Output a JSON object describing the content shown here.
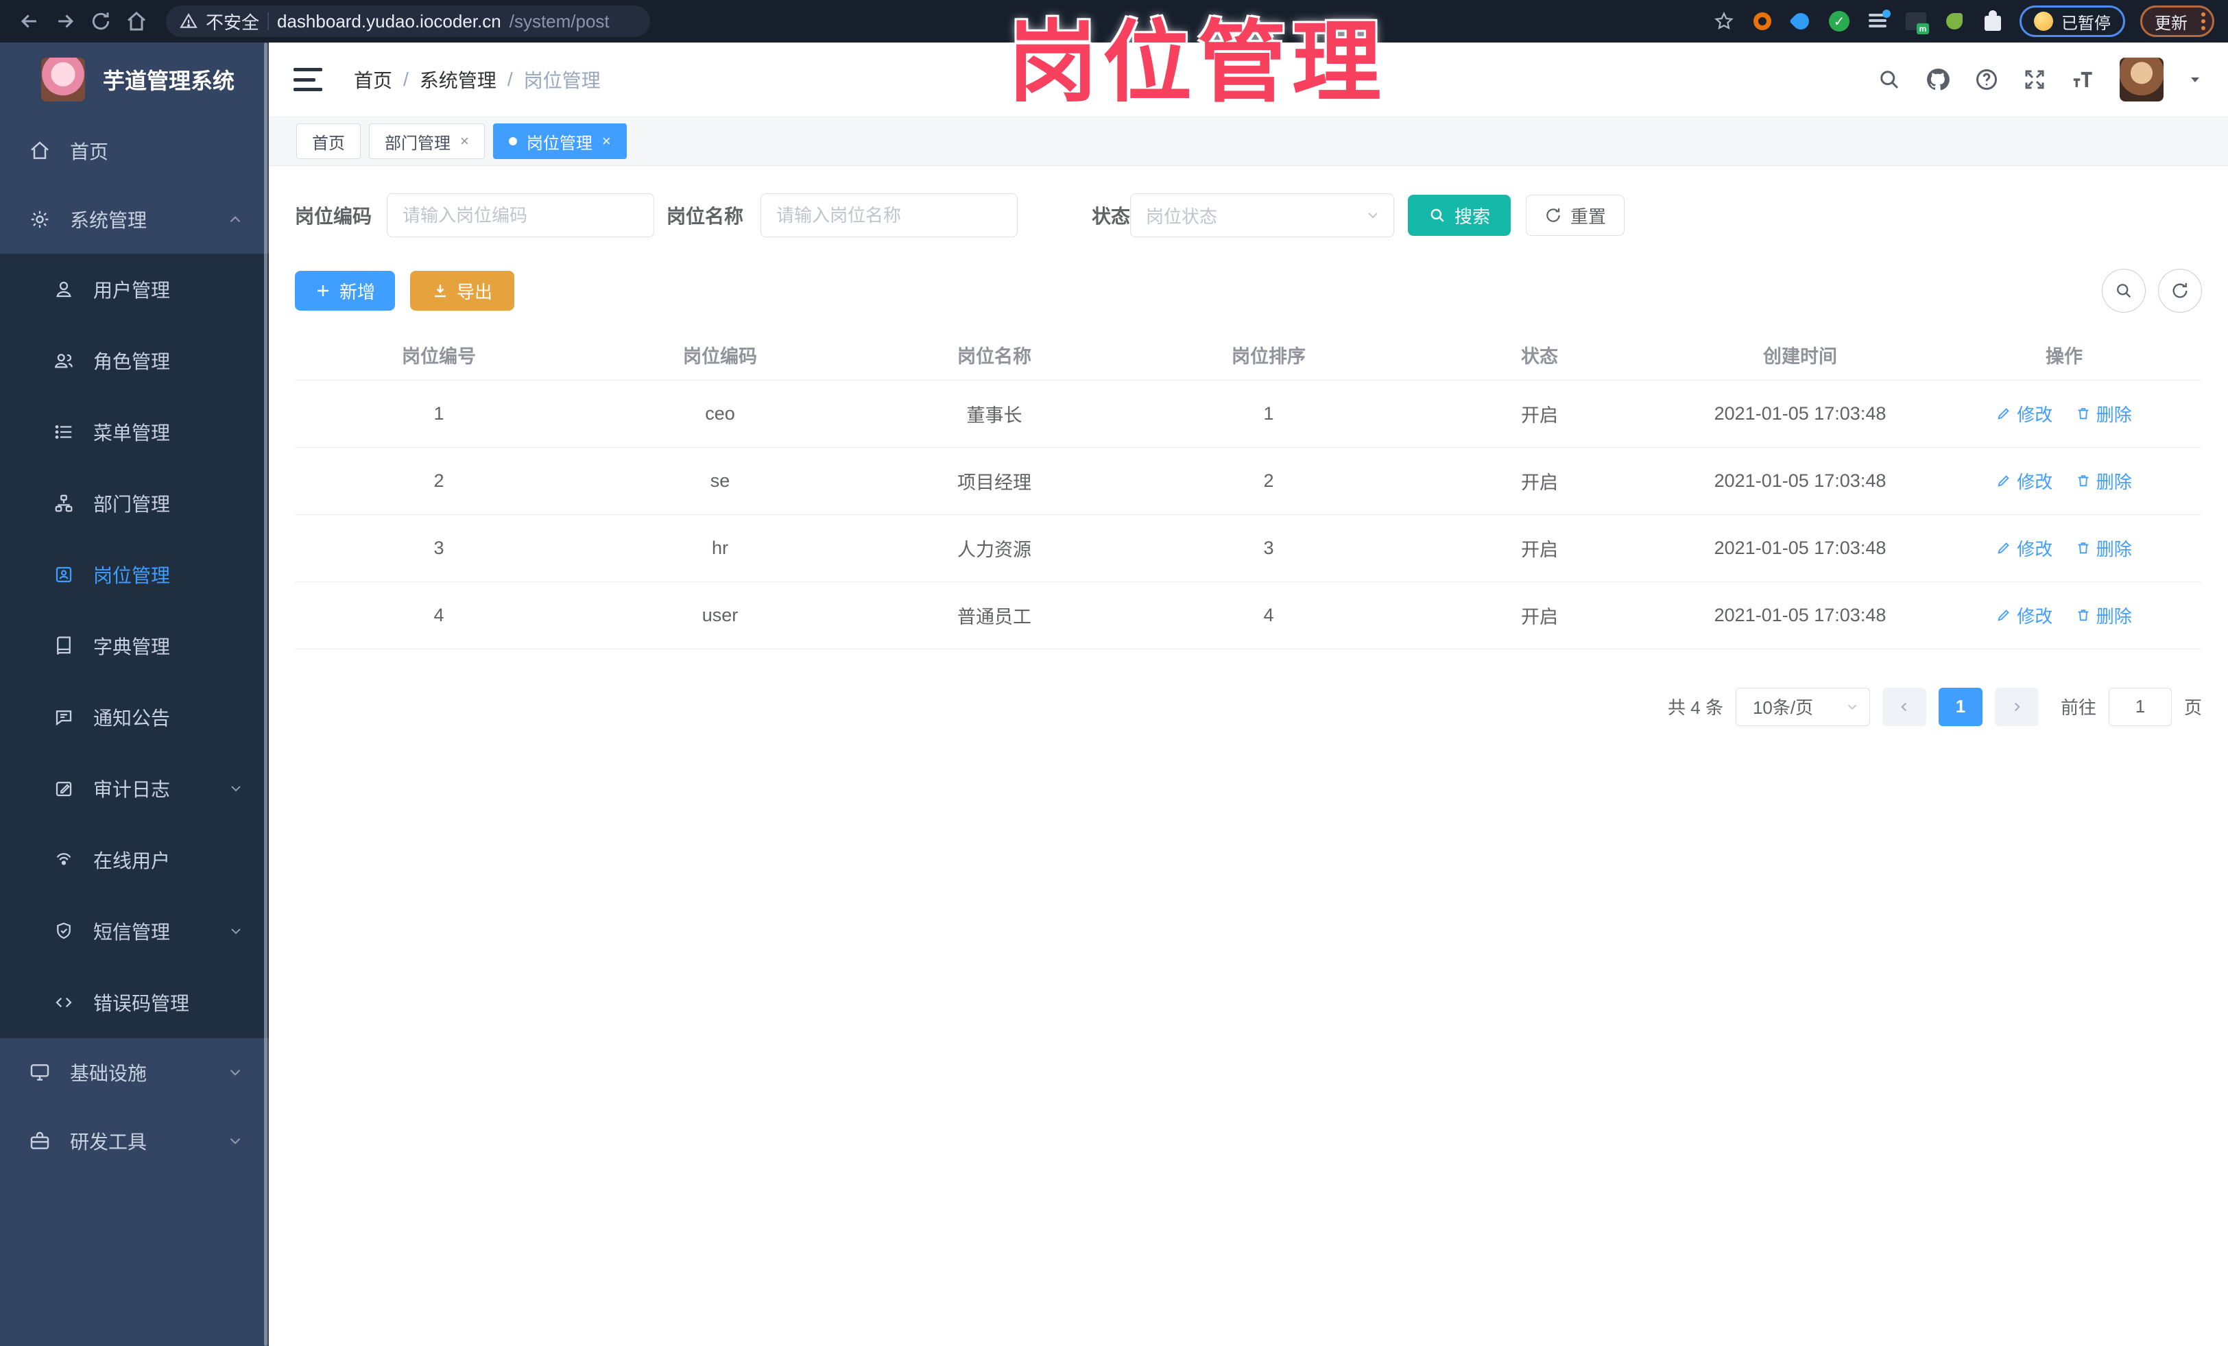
{
  "overlay_title": "岗位管理",
  "browser": {
    "security_label": "不安全",
    "url_host": "dashboard.yudao.iocoder.cn",
    "url_path": "/system/post",
    "paused_badge": "已暂停",
    "update_button": "更新"
  },
  "sidebar": {
    "app_title": "芋道管理系统",
    "home": "首页",
    "system": "系统管理",
    "submenu": [
      {
        "label": "用户管理"
      },
      {
        "label": "角色管理"
      },
      {
        "label": "菜单管理"
      },
      {
        "label": "部门管理"
      },
      {
        "label": "岗位管理"
      },
      {
        "label": "字典管理"
      },
      {
        "label": "通知公告"
      },
      {
        "label": "审计日志"
      },
      {
        "label": "在线用户"
      },
      {
        "label": "短信管理"
      },
      {
        "label": "错误码管理"
      }
    ],
    "infra": "基础设施",
    "devtools": "研发工具"
  },
  "breadcrumb": [
    "首页",
    "系统管理",
    "岗位管理"
  ],
  "tabs": [
    {
      "label": "首页"
    },
    {
      "label": "部门管理"
    },
    {
      "label": "岗位管理"
    }
  ],
  "filters": {
    "code_label": "岗位编码",
    "code_placeholder": "请输入岗位编码",
    "name_label": "岗位名称",
    "name_placeholder": "请输入岗位名称",
    "status_label": "状态",
    "status_placeholder": "岗位状态",
    "search_label": "搜索",
    "reset_label": "重置"
  },
  "toolbar": {
    "add_label": "新增",
    "export_label": "导出"
  },
  "table": {
    "headers": [
      "岗位编号",
      "岗位编码",
      "岗位名称",
      "岗位排序",
      "状态",
      "创建时间",
      "操作"
    ],
    "actions": {
      "edit": "修改",
      "delete": "删除"
    },
    "rows": [
      {
        "id": "1",
        "code": "ceo",
        "name": "董事长",
        "sort": "1",
        "status": "开启",
        "created": "2021-01-05 17:03:48"
      },
      {
        "id": "2",
        "code": "se",
        "name": "项目经理",
        "sort": "2",
        "status": "开启",
        "created": "2021-01-05 17:03:48"
      },
      {
        "id": "3",
        "code": "hr",
        "name": "人力资源",
        "sort": "3",
        "status": "开启",
        "created": "2021-01-05 17:03:48"
      },
      {
        "id": "4",
        "code": "user",
        "name": "普通员工",
        "sort": "4",
        "status": "开启",
        "created": "2021-01-05 17:03:48"
      }
    ]
  },
  "pagination": {
    "total_text": "共 4 条",
    "page_size": "10条/页",
    "current_page": "1",
    "goto_label": "前往",
    "goto_value": "1",
    "page_label": "页"
  },
  "colors": {
    "accent_blue": "#409eff",
    "teal": "#16b8aa",
    "warning_orange": "#e6a23c",
    "sidebar_bg": "#344563",
    "submenu_bg": "#202f40",
    "annotation_pink": "#f7415f"
  }
}
